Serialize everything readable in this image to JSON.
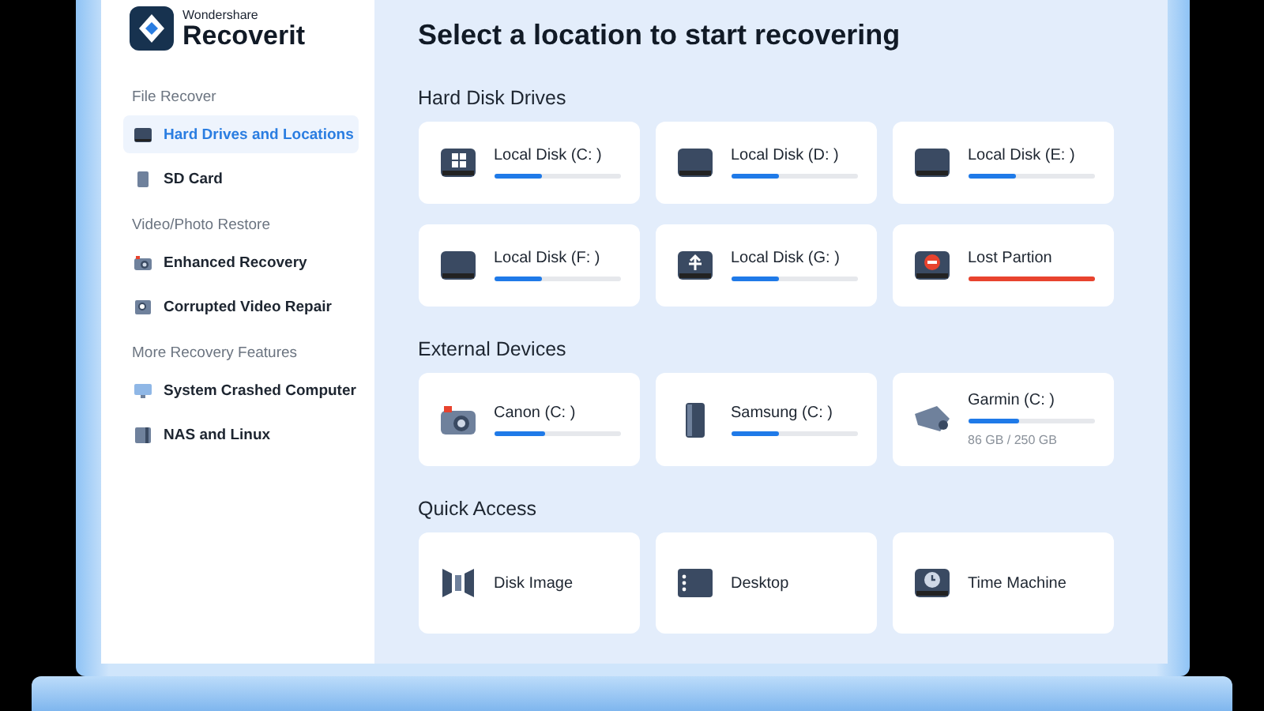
{
  "brand": {
    "company": "Wondershare",
    "product": "Recoverit"
  },
  "sidebar": {
    "sections": [
      {
        "heading": "File Recover",
        "items": [
          {
            "label": "Hard Drives and Locations",
            "kind": "drive",
            "selected": true
          },
          {
            "label": "SD Card",
            "kind": "card",
            "selected": false
          }
        ]
      },
      {
        "heading": "Video/Photo Restore",
        "items": [
          {
            "label": "Enhanced Recovery",
            "kind": "camera",
            "selected": false
          },
          {
            "label": "Corrupted Video Repair",
            "kind": "repair",
            "selected": false
          }
        ]
      },
      {
        "heading": "More Recovery Features",
        "items": [
          {
            "label": "System Crashed Computer",
            "kind": "monitor",
            "selected": false
          },
          {
            "label": "NAS and Linux",
            "kind": "nas",
            "selected": false
          }
        ]
      }
    ]
  },
  "title": "Select a location to start recovering",
  "groups": [
    {
      "heading": "Hard Disk Drives",
      "cards": [
        {
          "label": "Local Disk (C: )",
          "kind": "windows",
          "level": 0.38,
          "color": "#1f7ae8"
        },
        {
          "label": "Local Disk (D: )",
          "kind": "drive",
          "level": 0.38,
          "color": "#1f7ae8"
        },
        {
          "label": "Local Disk (E: )",
          "kind": "drive",
          "level": 0.38,
          "color": "#1f7ae8"
        },
        {
          "label": "Local Disk (F: )",
          "kind": "drive",
          "level": 0.38,
          "color": "#1f7ae8"
        },
        {
          "label": "Local Disk (G: )",
          "kind": "usb",
          "level": 0.38,
          "color": "#1f7ae8"
        },
        {
          "label": "Lost Partion",
          "kind": "lost",
          "level": 1,
          "color": "#e8432e"
        }
      ]
    },
    {
      "heading": "External Devices",
      "cards": [
        {
          "label": "Canon (C: )",
          "kind": "camera",
          "level": 0.4,
          "color": "#1f7ae8"
        },
        {
          "label": "Samsung (C: )",
          "kind": "phone",
          "level": 0.38,
          "color": "#1f7ae8"
        },
        {
          "label": "Garmin (C: )",
          "kind": "dashcam",
          "level": 0.4,
          "color": "#1f7ae8",
          "usage": "86 GB / 250 GB"
        }
      ]
    },
    {
      "heading": "Quick Access",
      "cards": [
        {
          "label": "Disk Image",
          "kind": "image"
        },
        {
          "label": "Desktop",
          "kind": "desktop"
        },
        {
          "label": "Time Machine",
          "kind": "clock"
        }
      ]
    }
  ]
}
